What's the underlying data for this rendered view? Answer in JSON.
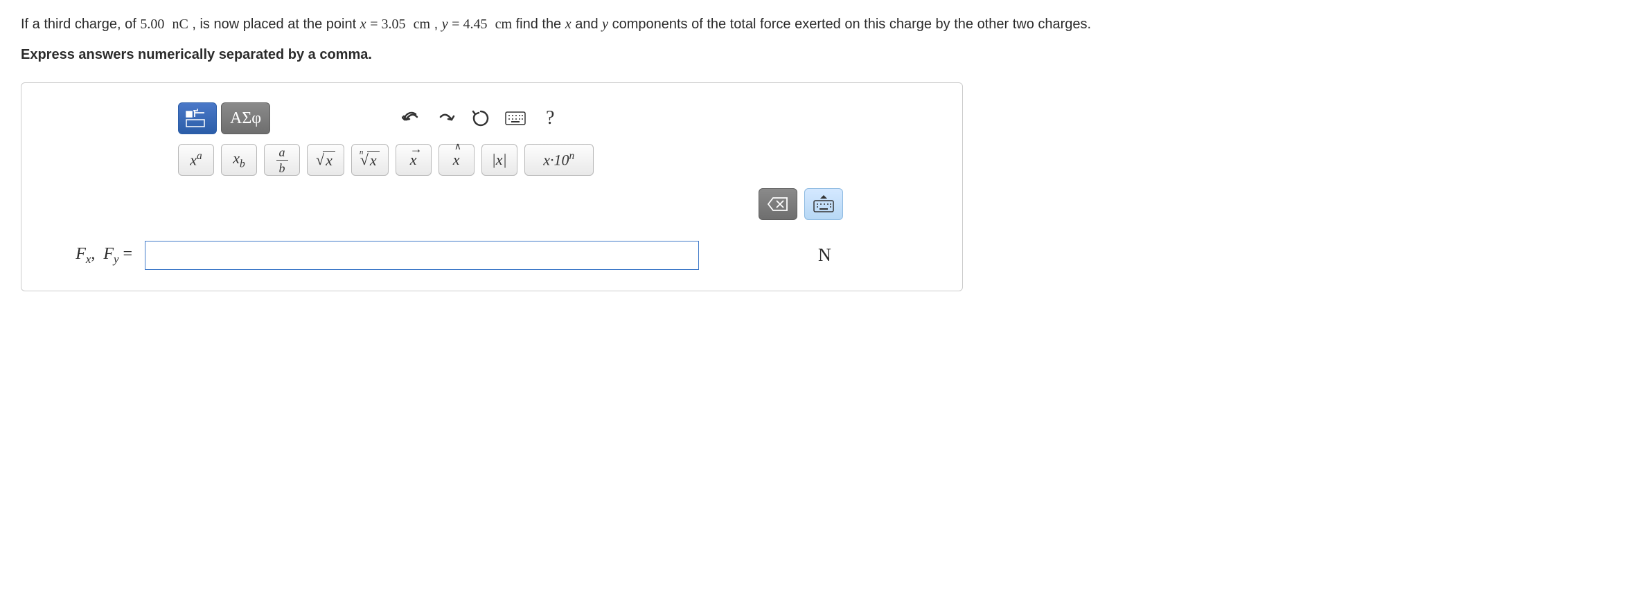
{
  "question": {
    "prefix": "If a third charge, of ",
    "charge_val": "5.00",
    "charge_unit": "nC",
    "mid1": " , is now placed at the point ",
    "x_var": "x",
    "eq1": " = ",
    "x_val": "3.05",
    "x_unit": "cm",
    "sep": " , ",
    "y_var": "y",
    "eq2": " = ",
    "y_val": "4.45",
    "y_unit": "cm",
    "mid2": " find the ",
    "and": " and ",
    "suffix": " components of the total force exerted on this charge by the other two charges."
  },
  "instruction": "Express answers numerically separated by a comma.",
  "toolbar": {
    "greek_label": "ΑΣφ",
    "sup_label_base": "x",
    "sup_label_exp": "a",
    "sub_label_base": "x",
    "sub_label_sub": "b",
    "frac_num": "a",
    "frac_den": "b",
    "sqrt_arg": "x",
    "nroot_n": "n",
    "nroot_arg": "x",
    "vec_arg": "x",
    "hat_arg": "x",
    "abs_label": "|x|",
    "sci_label": "x·10",
    "sci_exp": "n"
  },
  "answer": {
    "label_Fx": "F",
    "label_Fx_sub": "x",
    "label_comma": ", ",
    "label_Fy": "F",
    "label_Fy_sub": "y",
    "equals": " = ",
    "value": "",
    "unit": "N"
  }
}
